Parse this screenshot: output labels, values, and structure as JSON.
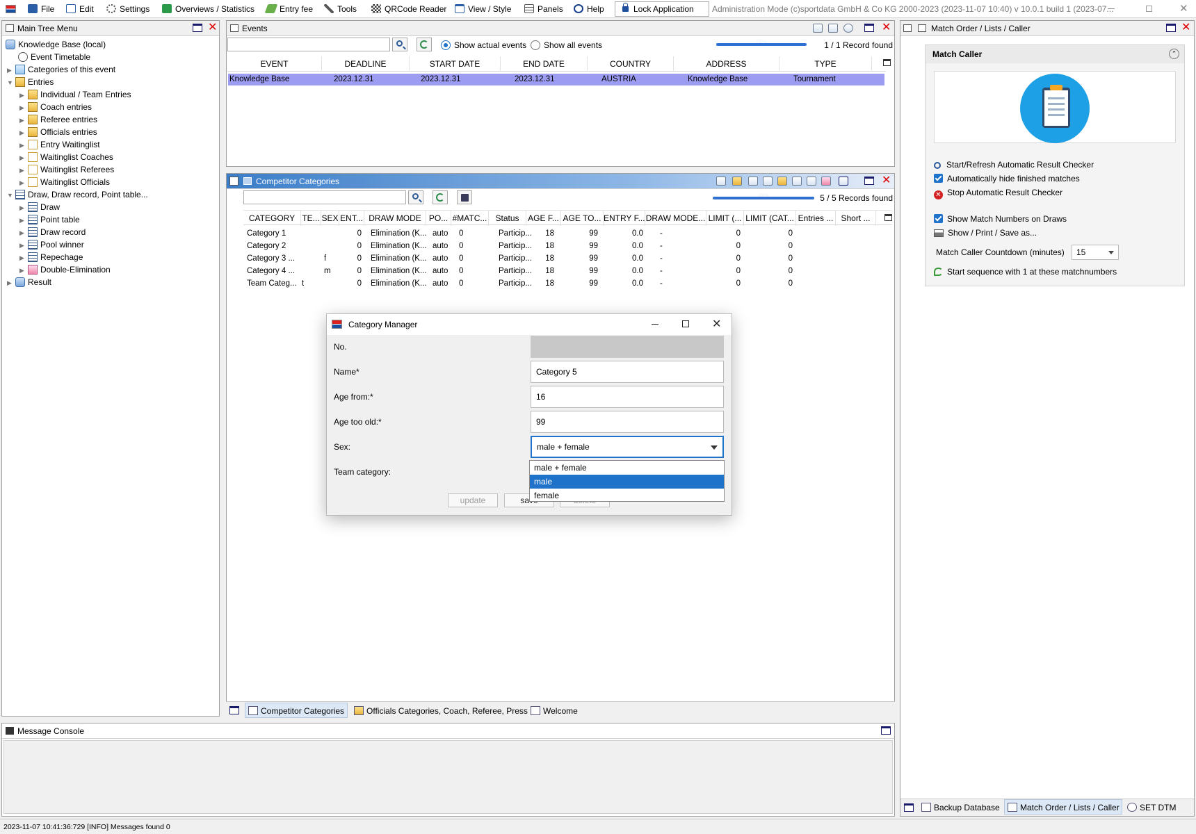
{
  "menubar": {
    "items": [
      {
        "label": "File"
      },
      {
        "label": "Edit"
      },
      {
        "label": "Settings"
      },
      {
        "label": "Overviews / Statistics"
      },
      {
        "label": "Entry fee"
      },
      {
        "label": "Tools"
      },
      {
        "label": "QRCode Reader"
      },
      {
        "label": "View / Style"
      },
      {
        "label": "Panels"
      },
      {
        "label": "Help"
      }
    ],
    "lock_label": "Lock Application",
    "admin_text": "Administration Mode (c)sportdata GmbH & Co KG 2000-2023 (2023-11-07 10:40)  v 10.0.1 build 1 (2023-07..."
  },
  "tree": {
    "title": "Main Tree Menu",
    "items": [
      {
        "label": "Knowledge Base (local)"
      },
      {
        "label": "Event Timetable"
      },
      {
        "label": "Categories of this event"
      },
      {
        "label": "Entries"
      },
      {
        "label": "Individual / Team Entries"
      },
      {
        "label": "Coach entries"
      },
      {
        "label": "Referee entries"
      },
      {
        "label": "Officials entries"
      },
      {
        "label": "Entry Waitinglist"
      },
      {
        "label": "Waitinglist Coaches"
      },
      {
        "label": "Waitinglist Referees"
      },
      {
        "label": "Waitinglist Officials"
      },
      {
        "label": "Draw, Draw record, Point table..."
      },
      {
        "label": "Draw"
      },
      {
        "label": "Point table"
      },
      {
        "label": "Draw record"
      },
      {
        "label": "Pool winner"
      },
      {
        "label": "Repechage"
      },
      {
        "label": "Double-Elimination"
      },
      {
        "label": "Result"
      }
    ]
  },
  "events": {
    "title": "Events",
    "show_actual": "Show actual events",
    "show_all": "Show all events",
    "records": "1 / 1 Record found",
    "progress_text": "100%",
    "columns": [
      "EVENT",
      "DEADLINE",
      "START DATE",
      "END DATE",
      "COUNTRY",
      "ADDRESS",
      "TYPE"
    ],
    "rows": [
      [
        "Knowledge Base",
        "2023.12.31",
        "2023.12.31",
        "2023.12.31",
        "AUSTRIA",
        "Knowledge Base",
        "Tournament"
      ]
    ]
  },
  "categories": {
    "title": "Competitor Categories",
    "records": "5 / 5 Records found",
    "progress_text": "100%",
    "columns": [
      "CATEGORY",
      "TE...",
      "SEX",
      "ENT...",
      "DRAW MODE",
      "PO...",
      "#MATC...",
      "Status",
      "AGE F...",
      "AGE TO...",
      "ENTRY F...",
      "DRAW MODE...",
      "LIMIT (...",
      "LIMIT (CAT...",
      "Entries ...",
      "Short ..."
    ],
    "rows": [
      [
        "Category 1",
        "",
        "",
        "0",
        "Elimination (K...",
        "auto",
        "0",
        "Particip...",
        "18",
        "99",
        "0.0",
        "-",
        "0",
        "0"
      ],
      [
        "Category 2",
        "",
        "",
        "0",
        "Elimination (K...",
        "auto",
        "0",
        "Particip...",
        "18",
        "99",
        "0.0",
        "-",
        "0",
        "0"
      ],
      [
        "Category 3 ...",
        "",
        "f",
        "0",
        "Elimination (K...",
        "auto",
        "0",
        "Particip...",
        "18",
        "99",
        "0.0",
        "-",
        "0",
        "0"
      ],
      [
        "Category 4 ...",
        "",
        "m",
        "0",
        "Elimination (K...",
        "auto",
        "0",
        "Particip...",
        "18",
        "99",
        "0.0",
        "-",
        "0",
        "0"
      ],
      [
        "Team Categ...",
        "t",
        "",
        "0",
        "Elimination (K...",
        "auto",
        "0",
        "Particip...",
        "18",
        "99",
        "0.0",
        "-",
        "0",
        "0"
      ]
    ]
  },
  "center_tabs": [
    {
      "label": "Competitor Categories"
    },
    {
      "label": "Officials Categories, Coach, Referee, Press"
    },
    {
      "label": "Welcome"
    }
  ],
  "dialog": {
    "title": "Category Manager",
    "labels": {
      "no": "No.",
      "name": "Name*",
      "age_from": "Age from:*",
      "age_too_old": "Age too old:*",
      "sex": "Sex:",
      "team_category": "Team category:"
    },
    "values": {
      "name": "Category 5",
      "age_from": "16",
      "age_too_old": "99",
      "sex": "male + female"
    },
    "sex_options": [
      "male + female",
      "male",
      "female"
    ],
    "buttons": {
      "update": "update",
      "save": "save",
      "delete": "delete"
    }
  },
  "right_panel": {
    "title": "Match Order / Lists / Caller",
    "section_title": "Match Caller",
    "start_refresh": "Start/Refresh Automatic Result Checker",
    "auto_hide": "Automatically hide finished matches",
    "stop_checker": "Stop Automatic Result Checker",
    "show_numbers": "Show Match Numbers on Draws",
    "show_print": "Show / Print / Save as...",
    "countdown_label": "Match Caller Countdown (minutes)",
    "countdown_value": "15",
    "start_sequence": "Start sequence with 1 at these matchnumbers",
    "tabs": [
      {
        "label": "Backup Database"
      },
      {
        "label": "Match Order / Lists / Caller"
      },
      {
        "label": "SET DTM"
      }
    ]
  },
  "console": {
    "title": "Message Console",
    "status": "2023-11-07 10:41:36:729 [INFO] Messages found 0"
  }
}
